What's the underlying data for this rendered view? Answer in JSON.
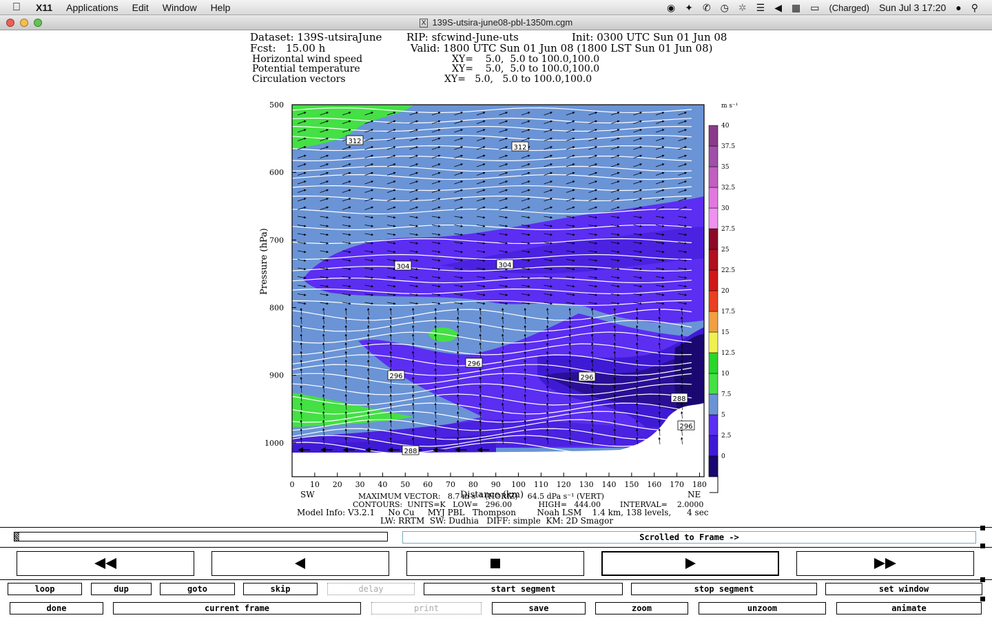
{
  "menubar": {
    "app_name": "X11",
    "items": [
      "Applications",
      "Edit",
      "Window",
      "Help"
    ],
    "battery": "(Charged)",
    "datetime": "Sun Jul 3  17:20"
  },
  "window": {
    "title": "139S-utsira-june08-pbl-1350m.cgm",
    "x_icon": "X"
  },
  "plot_header": {
    "dataset": "Dataset: 139S-utsiraJune",
    "rip": "RIP: sfcwind-June-uts",
    "init": "Init: 0300 UTC Sun 01 Jun 08",
    "fcst": "Fcst:   15.00 h",
    "valid": "Valid: 1800 UTC Sun 01 Jun 08 (1800 LST Sun 01 Jun 08)",
    "fields": [
      {
        "name": "Horizontal wind speed",
        "xy": "XY=    5.0,  5.0 to 100.0,100.0"
      },
      {
        "name": "Potential temperature",
        "xy": "XY=    5.0,  5.0 to 100.0,100.0"
      },
      {
        "name": "Circulation vectors",
        "xy": "XY=   5.0,   5.0 to 100.0,100.0"
      }
    ]
  },
  "chart_data": {
    "type": "heatmap",
    "title": "",
    "xlabel": "Distance (km)",
    "ylabel": "Pressure (hPa)",
    "x_ticks": [
      0,
      10,
      20,
      30,
      40,
      50,
      60,
      70,
      80,
      90,
      100,
      110,
      120,
      130,
      140,
      150,
      160,
      170,
      180
    ],
    "y_ticks": [
      500,
      600,
      700,
      800,
      900,
      1000
    ],
    "xlim": [
      0,
      182
    ],
    "ylim": [
      1050,
      500
    ],
    "left_end_label": "SW",
    "right_end_label": "NE",
    "colorbar": {
      "unit": "m s⁻¹",
      "labels": [
        "0",
        "2.5",
        "5",
        "7.5",
        "10",
        "12.5",
        "15",
        "17.5",
        "20",
        "22.5",
        "25",
        "27.5",
        "30",
        "32.5",
        "35",
        "37.5",
        "40"
      ],
      "colors": [
        "#2a0f96",
        "#3f1ad4",
        "#5b2ef2",
        "#6a94d6",
        "#44e044",
        "#2ad62a",
        "#f0f050",
        "#f0a040",
        "#e84020",
        "#d01818",
        "#b01020",
        "#8c0a28",
        "#f090f0",
        "#e078e0",
        "#c060c0",
        "#a050a8",
        "#8a3a8a"
      ]
    },
    "contour_labels": [
      "312",
      "312",
      "304",
      "304",
      "296",
      "296",
      "296",
      "288",
      "296",
      "288"
    ],
    "footer": {
      "maximum_vector": "MAXIMUM VECTOR:   8.7 m s⁻¹ (HORIZ)    64.5 dPa s⁻¹ (VERT)",
      "contours": "CONTOURS:  UNITS=K   LOW=   296.00           HIGH=   444.00        INTERVAL=    2.0000",
      "model_info": "Model Info: V3.2.1     No Cu     MYJ PBL   Thompson        Noah LSM    1.4 km, 138 levels,      4 sec",
      "model_info2": "LW: RRTM  SW: Dudhia   DIFF: simple  KM: 2D Smagor"
    }
  },
  "controls": {
    "status": "Scrolled to Frame ->",
    "row1": [
      "loop",
      "dup",
      "goto",
      "skip",
      "delay",
      "start segment",
      "stop segment",
      "set window"
    ],
    "row2": [
      "done",
      "current frame",
      "print",
      "save",
      "zoom",
      "unzoom",
      "animate"
    ]
  }
}
